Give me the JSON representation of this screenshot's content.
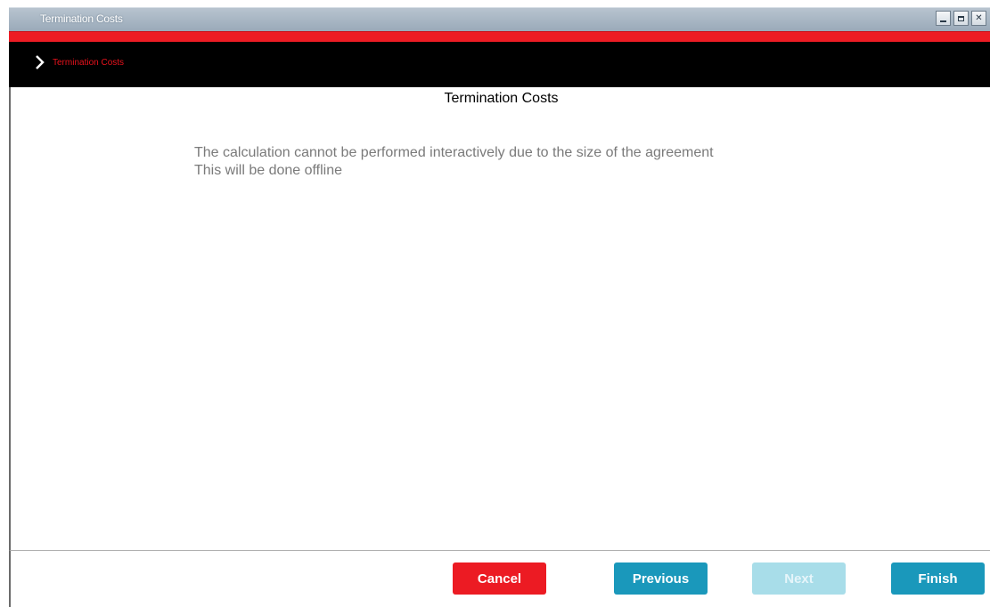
{
  "window": {
    "title": "Termination Costs",
    "controls": {
      "minimize": "minimize-icon",
      "maximize": "maximize-icon",
      "close": "close-icon",
      "close_glyph": "✕"
    }
  },
  "breadcrumb": {
    "icon": "chevron-right-icon",
    "label": "Termination Costs"
  },
  "main": {
    "title": "Termination Costs",
    "message_line1": "The calculation cannot be performed interactively due to the size of the agreement",
    "message_line2": "This will be done offline"
  },
  "footer": {
    "cancel_label": "Cancel",
    "previous_label": "Previous",
    "next_label": "Next",
    "finish_label": "Finish",
    "next_disabled": true
  },
  "colors": {
    "brand_red": "#ec1b23",
    "primary_blue": "#1a98bb",
    "disabled_blue": "#a8dde9",
    "nav_bar": "#000000"
  }
}
